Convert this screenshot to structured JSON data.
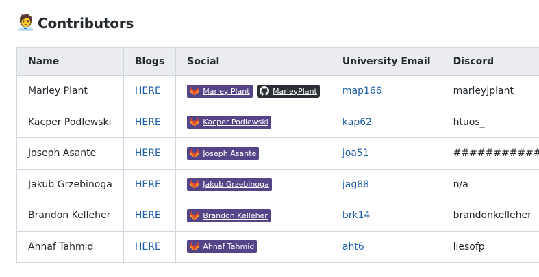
{
  "heading": {
    "emoji": "🧑‍💼",
    "title": "Contributors"
  },
  "table": {
    "columns": [
      "Name",
      "Blogs",
      "Social",
      "University Email",
      "Discord"
    ],
    "rows": [
      {
        "name": "Marley Plant",
        "blog": "HERE",
        "gitlab": "Marley Plant",
        "github": "MarleyPlant",
        "email": "map166",
        "discord": "marleyjplant"
      },
      {
        "name": "Kacper Podlewski",
        "blog": "HERE",
        "gitlab": "Kacper Podlewski",
        "email": "kap62",
        "discord": "htuos_"
      },
      {
        "name": "Joseph Asante",
        "blog": "HERE",
        "gitlab": "Joseph Asante",
        "email": "joa51",
        "discord": "############"
      },
      {
        "name": "Jakub Grzebinoga",
        "blog": "HERE",
        "gitlab": "Jakub Grzebinoga",
        "email": "jag88",
        "discord": "n/a"
      },
      {
        "name": "Brandon Kelleher",
        "blog": "HERE",
        "gitlab": "Brandon Kelleher",
        "email": "brk14",
        "discord": "brandonkelleher"
      },
      {
        "name": "Ahnaf Tahmid",
        "blog": "HERE",
        "gitlab": "Ahnaf Tahmid",
        "email": "aht6",
        "discord": "liesofp"
      }
    ]
  },
  "colors": {
    "link": "#1f5faa",
    "gitlab_badge": "#554488",
    "github_badge": "#2b2e34",
    "header_bg": "#ebecef"
  },
  "icons": {
    "gitlab": "gitlab-icon",
    "github": "github-icon"
  }
}
